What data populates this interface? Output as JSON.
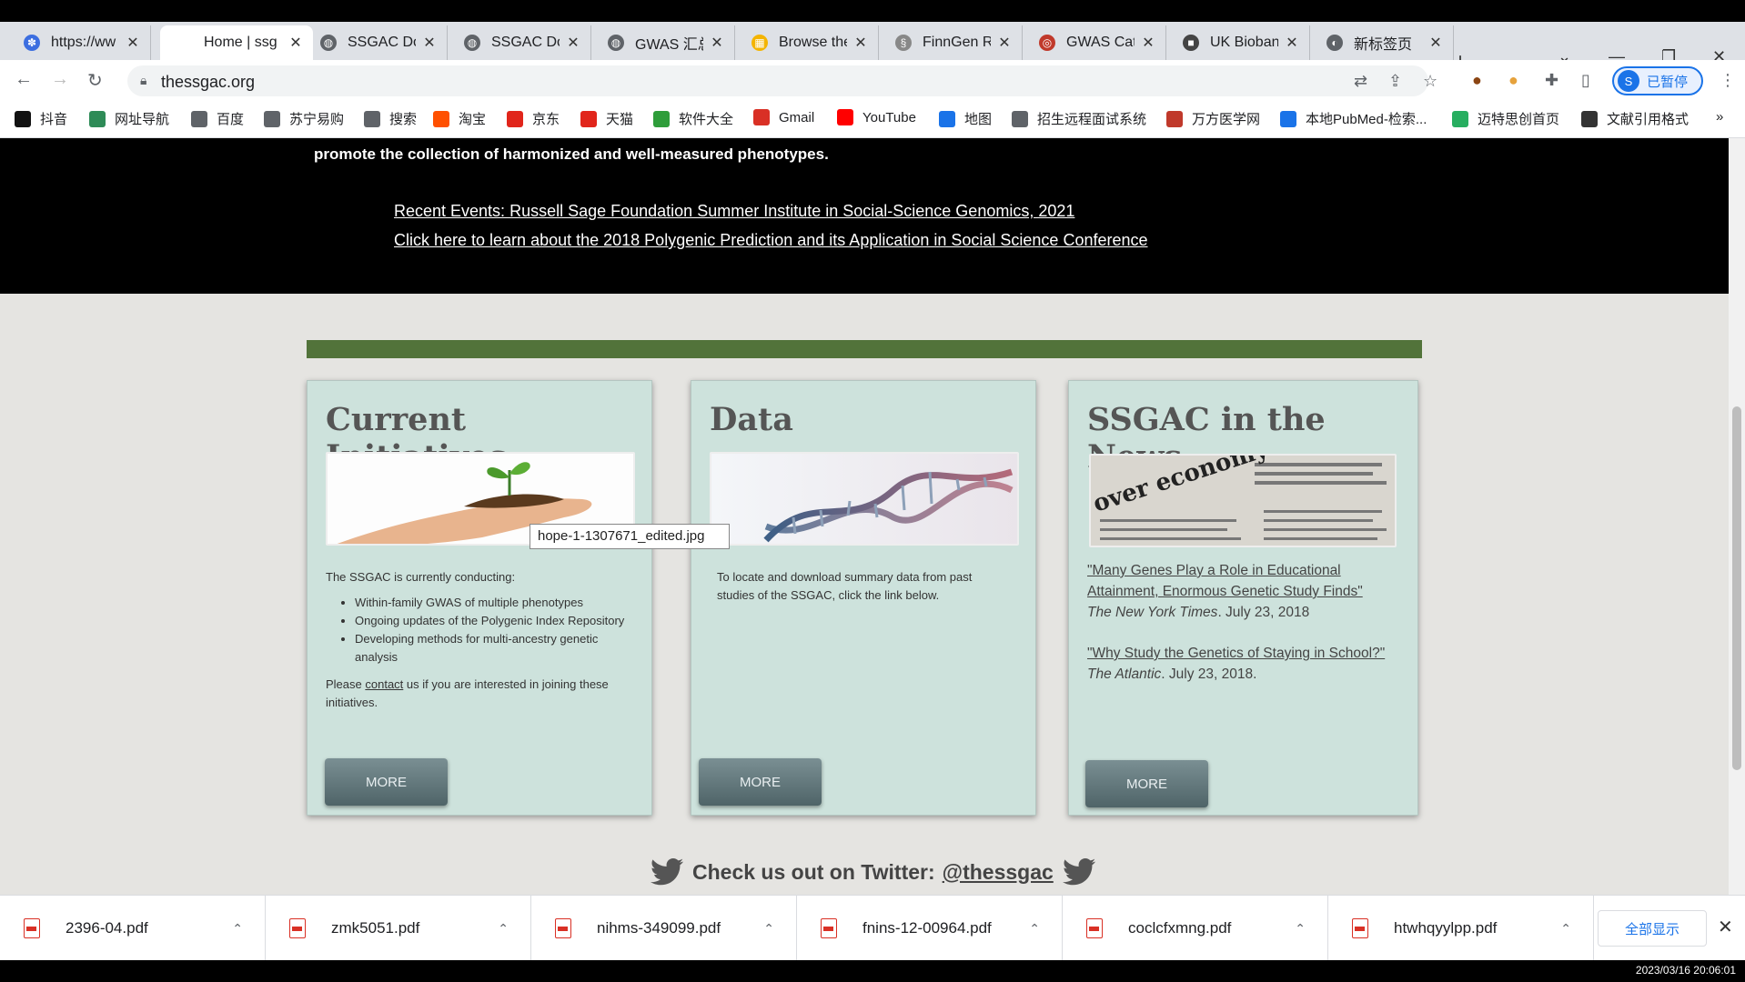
{
  "browser": {
    "tabs": [
      {
        "label": "https://ww",
        "color": "#3c6ee0",
        "glyph": "✽"
      },
      {
        "label": "Home | ssg",
        "color": "#ffffff",
        "glyph": ""
      },
      {
        "label": "SSGAC Do",
        "color": "#5f6368",
        "glyph": "◍"
      },
      {
        "label": "SSGAC Do",
        "color": "#5f6368",
        "glyph": "◍"
      },
      {
        "label": "GWAS 汇总",
        "color": "#5f6368",
        "glyph": "◍"
      },
      {
        "label": "Browse the",
        "color": "#f4b400",
        "glyph": "▦"
      },
      {
        "label": "FinnGen R",
        "color": "#888888",
        "glyph": "§"
      },
      {
        "label": "GWAS Cat",
        "color": "#c0392b",
        "glyph": "◎"
      },
      {
        "label": "UK Bioban",
        "color": "#444444",
        "glyph": "■"
      },
      {
        "label": "新标签页",
        "color": "#5f6368",
        "glyph": "◐"
      }
    ],
    "new_tab_glyph": "+",
    "url": "thessgac.org",
    "profile_initial": "S",
    "profile_label": "已暂停",
    "bookmarks": [
      {
        "label": "抖音",
        "color": "#111111"
      },
      {
        "label": "网址导航",
        "color": "#2e8b57"
      },
      {
        "label": "百度",
        "color": "#5f6368"
      },
      {
        "label": "苏宁易购",
        "color": "#5f6368"
      },
      {
        "label": "搜索",
        "color": "#5f6368"
      },
      {
        "label": "淘宝",
        "color": "#ff5000"
      },
      {
        "label": "京东",
        "color": "#e1251b"
      },
      {
        "label": "天猫",
        "color": "#e1251b"
      },
      {
        "label": "软件大全",
        "color": "#2e9d3a"
      },
      {
        "label": "Gmail",
        "color": "#d93025"
      },
      {
        "label": "YouTube",
        "color": "#ff0000"
      },
      {
        "label": "地图",
        "color": "#1a73e8"
      },
      {
        "label": "招生远程面试系统",
        "color": "#5f6368"
      },
      {
        "label": "万方医学网",
        "color": "#c0392b"
      },
      {
        "label": "本地PubMed-检索...",
        "color": "#1a73e8"
      },
      {
        "label": "迈特思创首页",
        "color": "#27ae60"
      },
      {
        "label": "文献引用格式",
        "color": "#333333"
      }
    ],
    "bookmarks_overflow": "»"
  },
  "page": {
    "hero_desc": "promote the collection of harmonized and well-measured phenotypes.",
    "hero_link_1": "Recent Events: Russell Sage Foundation Summer Institute in Social-Science Genomics, 2021",
    "hero_link_2": "Click here to learn about the 2018 Polygenic Prediction and its Application in Social Science Conference",
    "accent_color": "#52733a",
    "initiatives": {
      "title": "Current Initiatives",
      "intro": "The SSGAC is currently conducting:",
      "items": [
        "Within-family GWAS of multiple phenotypes",
        "Ongoing updates of the Polygenic Index Repository",
        "Developing methods for multi-ancestry genetic analysis"
      ],
      "please": "Please",
      "contact": "contact",
      "join_text": "us if you are interested in joining these initiatives.",
      "more": "MORE"
    },
    "data": {
      "title": "Data",
      "text": "To locate and download summary data from past studies of the SSGAC, click the link below.",
      "more": "MORE"
    },
    "news": {
      "title": "SSGAC in the News",
      "img_caption": "over economy",
      "item1_link": "\"Many Genes Play a Role in Educational Attainment, Enormous Genetic Study Finds\"",
      "item1_source": "The New York Times",
      "item1_date": ". July 23, 2018",
      "item2_link": "\"Why Study the Genetics of Staying in School?\"",
      "item2_source": "The Atlantic",
      "item2_date": ". July 23, 2018.",
      "more": "MORE"
    },
    "tooltip": "hope-1-1307671_edited.jpg",
    "twitter_text": "Check us out on Twitter:",
    "twitter_handle": "@thessgac"
  },
  "downloads": {
    "items": [
      "2396-04.pdf",
      "zmk5051.pdf",
      "nihms-349099.pdf",
      "fnins-12-00964.pdf",
      "coclcfxmng.pdf",
      "htwhqyylpp.pdf"
    ],
    "show_all": "全部显示"
  },
  "taskbar": {
    "clock": "2023/03/16 20:06:01"
  }
}
